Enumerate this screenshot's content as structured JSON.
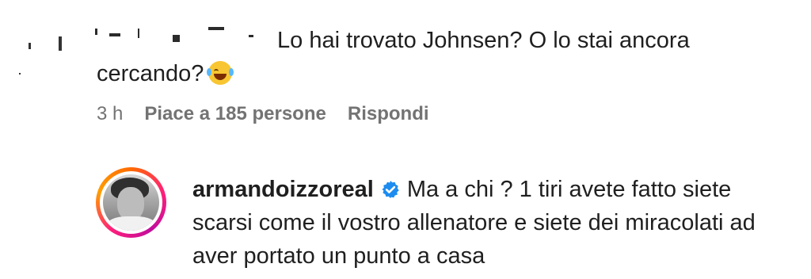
{
  "comment": {
    "text_part1": "Lo hai trovato Johnsen? O lo stai ancora",
    "text_part2": "cercando?",
    "time": "3 h",
    "likes": "Piace a 185 persone",
    "reply_label": "Rispondi"
  },
  "reply": {
    "username": "armandoizzoreal",
    "verified_icon": "verified-badge-icon",
    "text": "Ma a chi ? 1 tiri avete fatto siete scarsi come il vostro allenatore e siete dei miracolati ad aver portato un punto a casa"
  }
}
